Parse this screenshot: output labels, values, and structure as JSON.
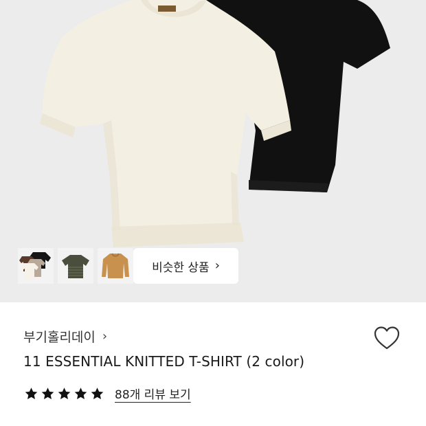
{
  "product_images": {
    "main_alt": "cream and black knitted t-shirts",
    "thumbnails": [
      {
        "name": "thumb-multicolor-tees"
      },
      {
        "name": "thumb-striped-tee"
      },
      {
        "name": "thumb-camel-sweater"
      }
    ]
  },
  "similar_button": {
    "label": "비슷한 상품",
    "chevron": "›"
  },
  "brand": {
    "name": "부기홀리데이",
    "chevron": "›"
  },
  "product": {
    "title": "11 ESSENTIAL KNITTED T-SHIRT (2 color)"
  },
  "rating": {
    "stars": 5,
    "review_link": "88개 리뷰 보기"
  },
  "icons": {
    "heart": "heart-outline-icon",
    "star": "star-filled-icon"
  },
  "colors": {
    "background": "#ececec",
    "cream": "#f4efe3",
    "black": "#111111",
    "star": "#111111"
  }
}
